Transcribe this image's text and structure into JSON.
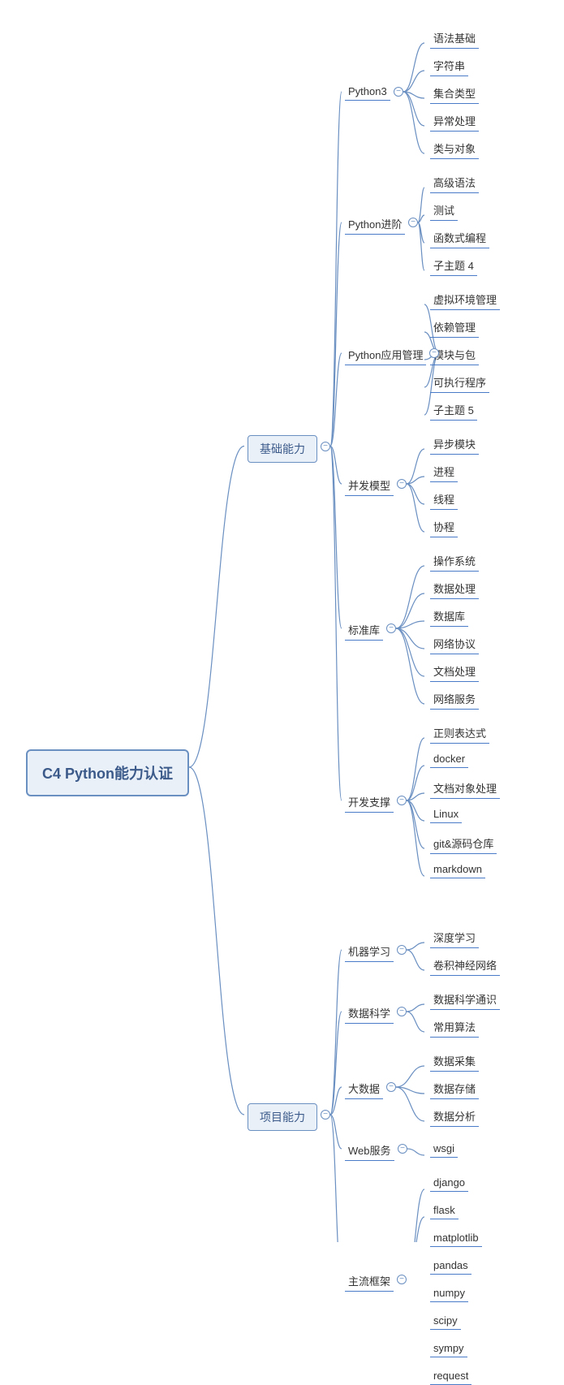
{
  "root": "C4 Python能力认证",
  "branches": {
    "basic": {
      "label": "基础能力",
      "children": {
        "python3": {
          "label": "Python3",
          "leaves": [
            "语法基础",
            "字符串",
            "集合类型",
            "异常处理",
            "类与对象"
          ]
        },
        "advanced": {
          "label": "Python进阶",
          "leaves": [
            "高级语法",
            "测试",
            "函数式编程",
            "子主题 4"
          ]
        },
        "appmgmt": {
          "label": "Python应用管理",
          "leaves": [
            "虚拟环境管理",
            "依赖管理",
            "模块与包",
            "可执行程序",
            "子主题 5"
          ]
        },
        "concurrency": {
          "label": "并发模型",
          "leaves": [
            "异步模块",
            "进程",
            "线程",
            "协程"
          ]
        },
        "stdlib": {
          "label": "标准库",
          "leaves": [
            "操作系统",
            "数据处理",
            "数据库",
            "网络协议",
            "文档处理",
            "网络服务"
          ]
        },
        "devsupport": {
          "label": "开发支撑",
          "leaves": [
            "正则表达式",
            "docker",
            "文档对象处理",
            "Linux",
            "git&源码仓库",
            "markdown"
          ]
        }
      }
    },
    "project": {
      "label": "项目能力",
      "children": {
        "ml": {
          "label": "机器学习",
          "leaves": [
            "深度学习",
            "卷积神经网络"
          ]
        },
        "datasci": {
          "label": "数据科学",
          "leaves": [
            "数据科学通识",
            "常用算法"
          ]
        },
        "bigdata": {
          "label": "大数据",
          "leaves": [
            "数据采集",
            "数据存储",
            "数据分析"
          ]
        },
        "web": {
          "label": "Web服务",
          "leaves": [
            "wsgi"
          ]
        },
        "frameworks": {
          "label": "主流框架",
          "leaves": [
            "django",
            "flask",
            "matplotlib",
            "pandas",
            "numpy",
            "scipy",
            "sympy",
            "request"
          ]
        }
      }
    }
  },
  "colors": {
    "line": "#6a8fc1",
    "midline": "#4a7bc8"
  }
}
